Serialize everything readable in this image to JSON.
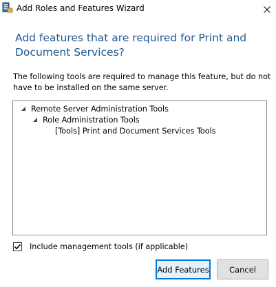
{
  "window": {
    "title": "Add Roles and Features Wizard",
    "icon": "server-manager-icon",
    "close_icon": "close-icon"
  },
  "heading": "Add features that are required for Print and Document Services?",
  "description": "The following tools are required to manage this feature, but do not have to be installed on the same server.",
  "tree": {
    "items": [
      {
        "label": "Remote Server Administration Tools",
        "level": 0,
        "expanded": true
      },
      {
        "label": "Role Administration Tools",
        "level": 1,
        "expanded": true
      },
      {
        "label": "[Tools] Print and Document Services Tools",
        "level": 2,
        "expanded": false
      }
    ]
  },
  "checkbox": {
    "label": "Include management tools (if applicable)",
    "checked": true
  },
  "buttons": {
    "add_features": "Add Features",
    "cancel": "Cancel"
  },
  "colors": {
    "heading": "#1e5a94",
    "primary_border": "#0078d7",
    "button_bg": "#e1e1e1"
  }
}
